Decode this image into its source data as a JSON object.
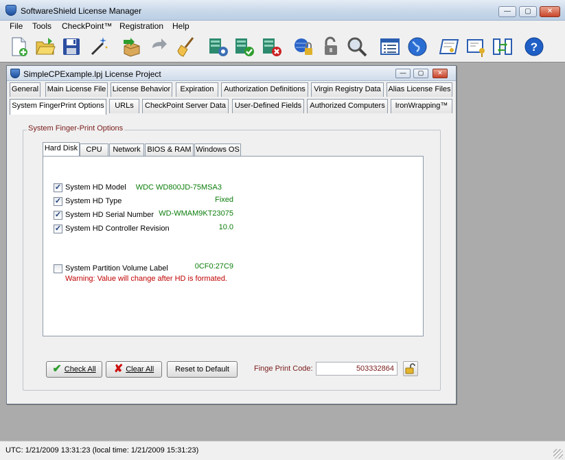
{
  "window": {
    "title": "SoftwareShield License Manager"
  },
  "menu": [
    "File",
    "Tools",
    "CheckPoint™",
    "Registration",
    "Help"
  ],
  "toolbar_icons": [
    "new-file-icon",
    "open-folder-icon",
    "save-disk-icon",
    "wizard-wand-icon",
    "import-box-icon",
    "forward-arrow-icon",
    "clean-broom-icon",
    "server-settings-icon",
    "server-ok-icon",
    "server-error-icon",
    "key-globe-icon",
    "padlock-open-icon",
    "search-magnifier-icon",
    "list-window-icon",
    "globe-icon",
    "certificate-icon",
    "key-card-icon",
    "transfer-arrows-icon",
    "help-icon"
  ],
  "project": {
    "title": "SimpleCPExample.lpj License Project",
    "tabs_row1": [
      "General",
      "Main License File",
      "License Behavior",
      "Expiration",
      "Authorization Definitions",
      "Virgin Registry Data",
      "Alias License Files"
    ],
    "tabs_row2": [
      "System FingerPrint Options",
      "URLs",
      "CheckPoint Server Data",
      "User-Defined Fields",
      "Authorized Computers",
      "IronWrapping™"
    ],
    "group_label": "System Finger-Print Options",
    "inner_tabs": [
      "Hard Disk",
      "CPU",
      "Network",
      "BIOS & RAM",
      "Windows OS"
    ],
    "options": [
      {
        "label": "System HD Model",
        "value": "WDC WD800JD-75MSA3",
        "checked": "✓"
      },
      {
        "label": "System HD Type",
        "value": "Fixed",
        "checked": "✓"
      },
      {
        "label": "System HD Serial Number",
        "value": "WD-WMAM9KT23075",
        "checked": "✓"
      },
      {
        "label": "System HD Controller Revision",
        "value": "10.0",
        "checked": "✓"
      }
    ],
    "partition": {
      "label": "System Partition Volume Label",
      "value": "0CF0:27C9",
      "checked": "",
      "warning": "Warning: Value will change after HD is formated."
    },
    "buttons": {
      "check_all": "Check All",
      "clear_all": "Clear All",
      "reset": "Reset to Default"
    },
    "fingerprint_label": "Finge Print Code:",
    "fingerprint_value": "503332864"
  },
  "status": "UTC: 1/21/2009 13:31:23  (local time: 1/21/2009 15:31:23)"
}
